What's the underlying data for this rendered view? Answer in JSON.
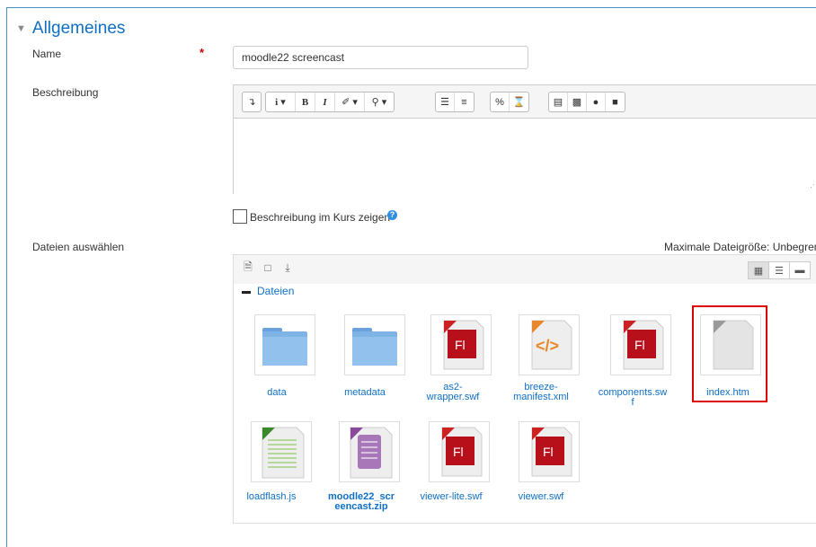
{
  "section": {
    "title": "Allgemeines"
  },
  "name_field": {
    "label": "Name",
    "required_mark": "*",
    "value": "moodle22 screencast"
  },
  "description": {
    "label": "Beschreibung"
  },
  "show_description": {
    "label": "Beschreibung im Kurs zeigen",
    "checked": false
  },
  "files": {
    "label": "Dateien auswählen",
    "max_size": "Maximale Dateigröße: Unbegrenzt",
    "path_root": "Dateien",
    "items": [
      {
        "name": "data",
        "type": "folder"
      },
      {
        "name": "metadata",
        "type": "folder"
      },
      {
        "name": "as2-\nwrapper.swf",
        "type": "flash"
      },
      {
        "name": "breeze-\nmanifest.xml",
        "type": "xml"
      },
      {
        "name": "components.sw\nf",
        "type": "flash"
      },
      {
        "name": "index.htm",
        "type": "html",
        "highlighted": true
      },
      {
        "name": "loadflash.js",
        "type": "js"
      },
      {
        "name": "moodle22_scr\neencast.zip",
        "type": "zip"
      },
      {
        "name": "viewer-lite.swf",
        "type": "flash"
      },
      {
        "name": "viewer.swf",
        "type": "flash"
      }
    ]
  },
  "colors": {
    "link": "#0f6fc5",
    "highlight": "#dd0000",
    "required": "#cc0000"
  }
}
